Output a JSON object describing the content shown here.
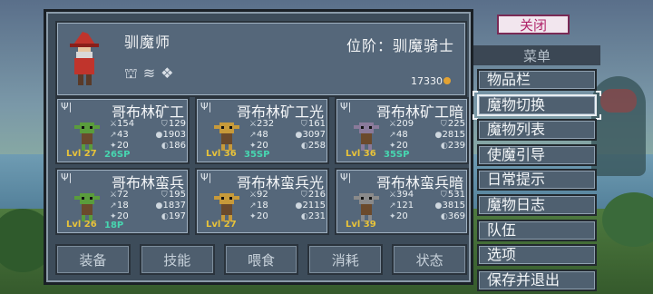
{
  "hero": {
    "name": "驯魔师",
    "rank": "位阶：驯魔骑士",
    "gold": "17330",
    "icons": [
      "tower-icon",
      "wind-icon",
      "gem-icon"
    ]
  },
  "monsters": [
    {
      "name": "哥布林矿工",
      "level": "Lvl 27",
      "sp": "26SP",
      "atk": "154",
      "hp": "43",
      "mag": "20",
      "def": "129",
      "xp": "1903",
      "drop": "186",
      "color": "#5a9c3c"
    },
    {
      "name": "哥布林矿工光",
      "level": "Lvl 36",
      "sp": "35SP",
      "atk": "232",
      "hp": "48",
      "mag": "20",
      "def": "161",
      "xp": "3097",
      "drop": "258",
      "color": "#c79a3a"
    },
    {
      "name": "哥布林矿工暗",
      "level": "Lvl 36",
      "sp": "35SP",
      "atk": "209",
      "hp": "48",
      "mag": "20",
      "def": "225",
      "xp": "2815",
      "drop": "239",
      "color": "#8a7a9a"
    },
    {
      "name": "哥布林蛮兵",
      "level": "Lvl 26",
      "sp": "18P",
      "atk": "72",
      "hp": "18",
      "mag": "20",
      "def": "195",
      "xp": "1837",
      "drop": "197",
      "color": "#5a9c3c"
    },
    {
      "name": "哥布林蛮兵光",
      "level": "Lvl 27",
      "sp": "",
      "atk": "92",
      "hp": "18",
      "mag": "20",
      "def": "216",
      "xp": "2115",
      "drop": "231",
      "color": "#c79a3a"
    },
    {
      "name": "哥布林蛮兵暗",
      "level": "Lvl 39",
      "sp": "",
      "atk": "394",
      "hp": "121",
      "mag": "20",
      "def": "531",
      "xp": "3815",
      "drop": "369",
      "color": "#8a8a8a"
    }
  ],
  "actions": [
    "装备",
    "技能",
    "喂食",
    "消耗",
    "状态"
  ],
  "close_label": "关闭",
  "menu": {
    "header": "菜单",
    "items": [
      "物品栏",
      "魔物切换",
      "魔物列表",
      "使魔引导",
      "日常提示",
      "魔物日志",
      "队伍",
      "选项",
      "保存并退出"
    ],
    "selected": "魔物切换"
  },
  "colors": {
    "panel": "#3d4c5a",
    "card": "#55677a",
    "level": "#e8c33a",
    "sp": "#47d6b0",
    "close": "#b0246a"
  }
}
